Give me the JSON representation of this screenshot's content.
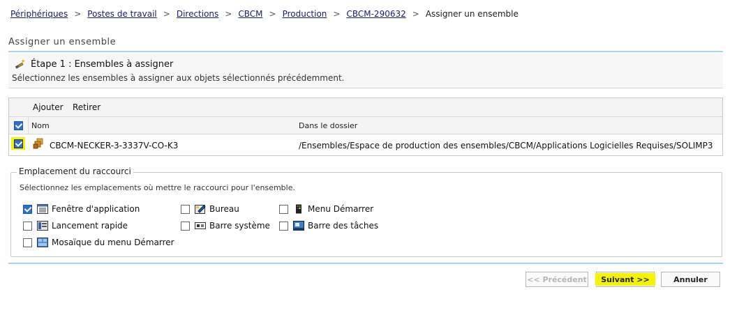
{
  "breadcrumb": {
    "items": [
      "Périphériques",
      "Postes de travail",
      "Directions",
      "CBCM",
      "Production",
      "CBCM-290632"
    ],
    "current": "Assigner un ensemble",
    "separator": ">"
  },
  "page": {
    "title": "Assigner un ensemble",
    "step_title": "Étape 1 : Ensembles à assigner",
    "step_description": "Sélectionnez les ensembles à assigner aux objets sélectionnés précédemment."
  },
  "table": {
    "toolbar": {
      "add_label": "Ajouter",
      "remove_label": "Retirer"
    },
    "columns": {
      "name": "Nom",
      "folder": "Dans le dossier"
    },
    "rows": [
      {
        "checked": true,
        "name": "CBCM-NECKER-3-3337V-CO-K3",
        "folder": "/Ensembles/Espace de production des ensembles/CBCM/Applications Logicielles Requises/SOLIMP3"
      }
    ],
    "header_checked": true
  },
  "shortcut": {
    "legend": "Emplacement du raccourci",
    "description": "Sélectionnez les emplacements où mettre le raccourci pour l'ensemble.",
    "options": [
      {
        "label": "Fenêtre d'application",
        "checked": true,
        "icon": "application-window-icon"
      },
      {
        "label": "Bureau",
        "checked": false,
        "icon": "desktop-icon"
      },
      {
        "label": "Menu Démarrer",
        "checked": false,
        "icon": "start-menu-icon"
      },
      {
        "label": "Lancement rapide",
        "checked": false,
        "icon": "quick-launch-icon"
      },
      {
        "label": "Barre système",
        "checked": false,
        "icon": "system-tray-icon"
      },
      {
        "label": "Barre des tâches",
        "checked": false,
        "icon": "taskbar-icon"
      },
      {
        "label": "Mosaïque du menu Démarrer",
        "checked": false,
        "icon": "start-menu-tile-icon"
      }
    ]
  },
  "buttons": {
    "previous": "<< Précédent",
    "next": "Suivant >>",
    "cancel": "Annuler"
  },
  "colors": {
    "link": "#1a1a6e",
    "accent_rule": "#a8d4ee",
    "checkbox_checked": "#2b6fd1",
    "highlight": "#f4f400"
  }
}
